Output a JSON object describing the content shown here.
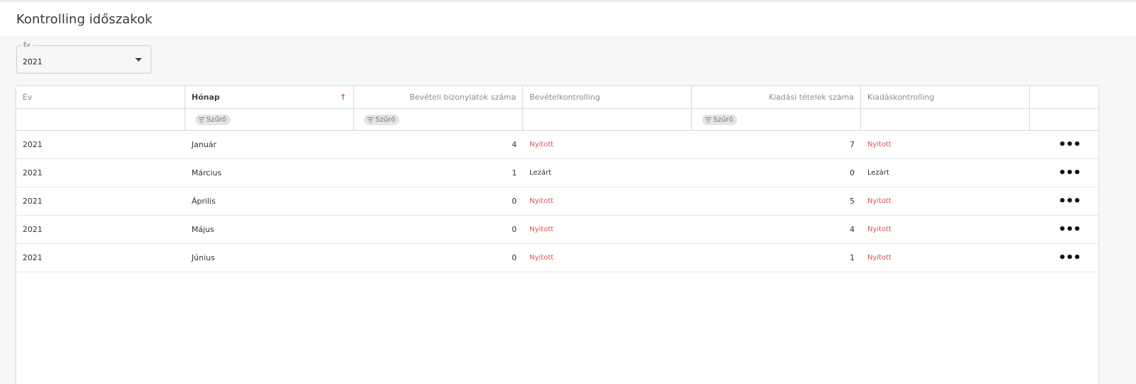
{
  "page": {
    "title": "Kontrolling időszakok"
  },
  "year_filter": {
    "label": "Év",
    "value": "2021"
  },
  "table": {
    "columns": [
      {
        "label": "Év"
      },
      {
        "label": "Hónap",
        "sorted": "ascending"
      },
      {
        "label": "Bevételi bizonylatok száma"
      },
      {
        "label": "Bevételkontrolling"
      },
      {
        "label": "Kiadási tételek száma"
      },
      {
        "label": "Kiadáskontrolling"
      },
      {
        "label": ""
      }
    ],
    "filter_chip_label": "Szűrő",
    "rows": [
      {
        "year": "2021",
        "month": "Január",
        "income_docs": "4",
        "income_status": "Nyitott",
        "expense_items": "7",
        "expense_status": "Nyitott",
        "actions": "•••"
      },
      {
        "year": "2021",
        "month": "Március",
        "income_docs": "1",
        "income_status": "Lezárt",
        "expense_items": "0",
        "expense_status": "Lezárt",
        "actions": "•••"
      },
      {
        "year": "2021",
        "month": "Április",
        "income_docs": "0",
        "income_status": "Nyitott",
        "expense_items": "5",
        "expense_status": "Nyitott",
        "actions": "•••"
      },
      {
        "year": "2021",
        "month": "Május",
        "income_docs": "0",
        "income_status": "Nyitott",
        "expense_items": "4",
        "expense_status": "Nyitott",
        "actions": "•••"
      },
      {
        "year": "2021",
        "month": "Június",
        "income_docs": "0",
        "income_status": "Nyitott",
        "expense_items": "1",
        "expense_status": "Nyitott",
        "actions": "•••"
      }
    ]
  },
  "colors": {
    "open_status": "#d9534f",
    "sort_arrow": "#e0505a"
  },
  "icons": {
    "sort": "arrow-up-icon",
    "filter": "filter-icon",
    "dropdown": "caret-down-icon",
    "row_actions": "more-horizontal-icon"
  }
}
